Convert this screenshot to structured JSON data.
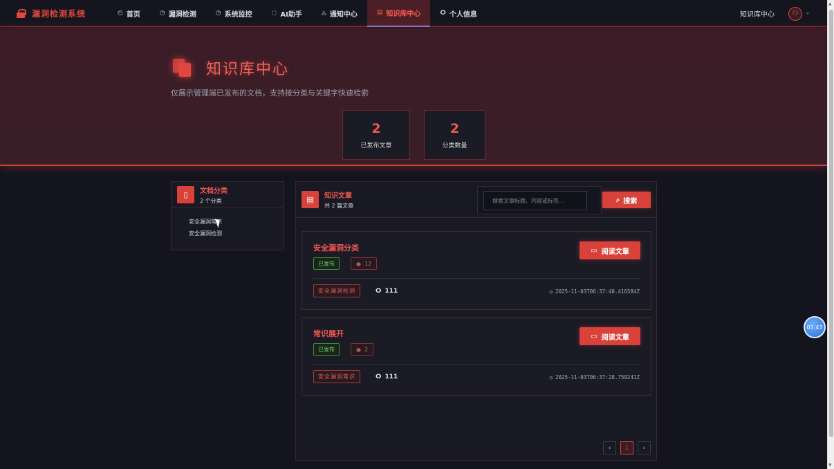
{
  "nav": {
    "brand": "漏洞检测系统",
    "items": [
      {
        "icon": "◴",
        "label": "首页",
        "active": false
      },
      {
        "icon": "◷",
        "label": "漏洞检测",
        "active": false
      },
      {
        "icon": "◷",
        "label": "系统监控",
        "active": false
      },
      {
        "icon": "◌",
        "label": "AI助手",
        "active": false
      },
      {
        "icon": "◬",
        "label": "通知中心",
        "active": false
      },
      {
        "icon": "▤",
        "label": "知识库中心",
        "active": true
      },
      {
        "icon": "ⵔ",
        "label": "个人信息",
        "active": false
      }
    ],
    "current_page": "知识库中心",
    "avatar_icon": "user-icon"
  },
  "hero": {
    "title": "知识库中心",
    "subtitle": "仅展示管理端已发布的文档，支持按分类与关键字快速检索",
    "stats": [
      {
        "value": "2",
        "label": "已发布文章"
      },
      {
        "value": "2",
        "label": "分类数量"
      }
    ]
  },
  "categories": {
    "title": "文档分类",
    "count_text": "2 个分类",
    "items": [
      "安全漏洞常识",
      "安全漏洞检测"
    ]
  },
  "articles": {
    "title": "知识文章",
    "count_text": "共 2 篇文章",
    "search_placeholder": "搜索文章标题、内容或标签...",
    "search_label": "搜索",
    "read_label": "阅读文章",
    "list": [
      {
        "title": "安全漏洞分类",
        "status": "已发布",
        "views": "12",
        "tag": "安全漏洞检测",
        "author": "111",
        "time": "2025-11-03T06:37:40.416584Z"
      },
      {
        "title": "常识展开",
        "status": "已发布",
        "views": "2",
        "tag": "安全漏洞常识",
        "author": "111",
        "time": "2025-11-03T06:37:28.759241Z"
      }
    ]
  },
  "pagination": {
    "prev": "‹",
    "current": "1",
    "next": "›"
  },
  "timer": "01:43",
  "colors": {
    "accent": "#d8423b",
    "success": "#6bd35f",
    "background": "#13141d"
  }
}
